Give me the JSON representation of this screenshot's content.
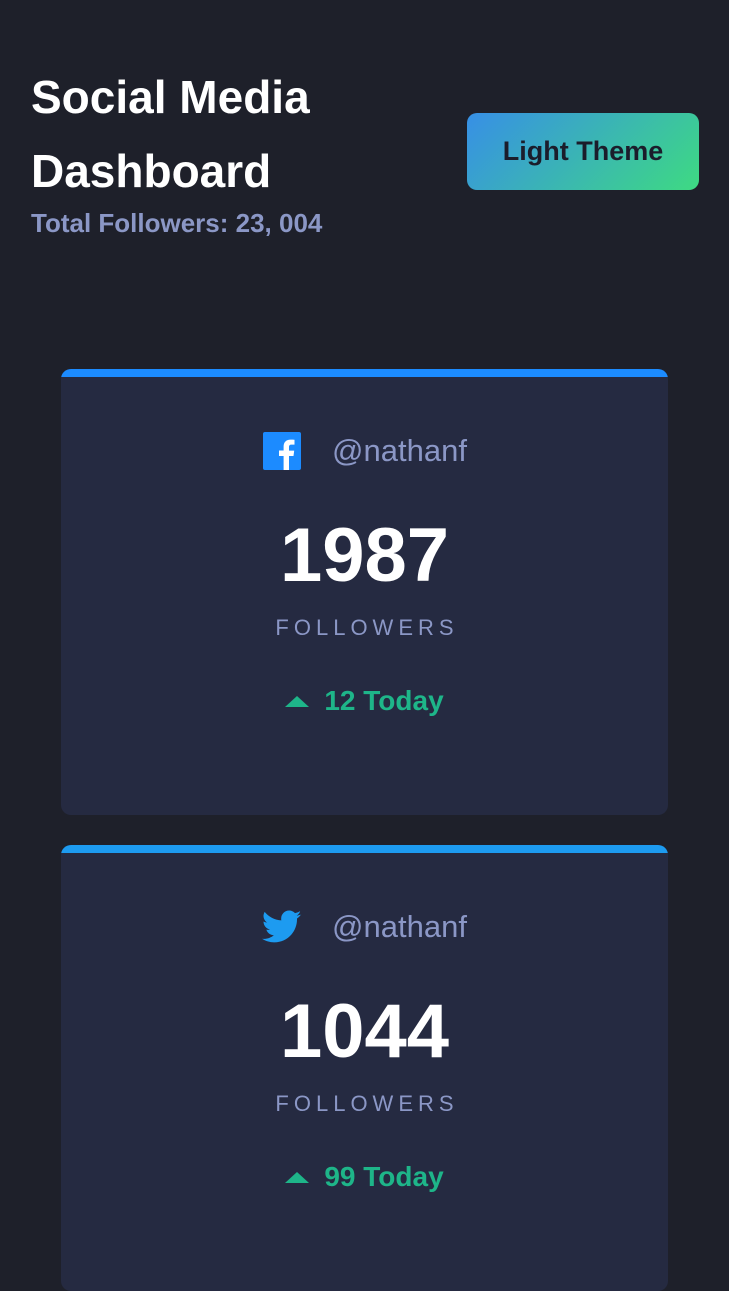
{
  "header": {
    "title_line1": "Social Media",
    "title_line2": "Dashboard",
    "total_followers": "Total Followers: 23, 004"
  },
  "theme_toggle": {
    "label": "Light Theme"
  },
  "colors": {
    "background": "#1e202a",
    "card": "#252a41",
    "muted_text": "#8b97c6",
    "up_green": "#1eb589",
    "facebook_blue": "#1c8bff",
    "twitter_blue": "#1d9bf0"
  },
  "cards": [
    {
      "network": "facebook",
      "icon": "facebook-icon",
      "handle": "@nathanf",
      "count": "1987",
      "label": "FOLLOWERS",
      "change": "12 Today",
      "trend_icon": "up-arrow-icon"
    },
    {
      "network": "twitter",
      "icon": "twitter-icon",
      "handle": "@nathanf",
      "count": "1044",
      "label": "FOLLOWERS",
      "change": "99 Today",
      "trend_icon": "up-arrow-icon"
    }
  ]
}
